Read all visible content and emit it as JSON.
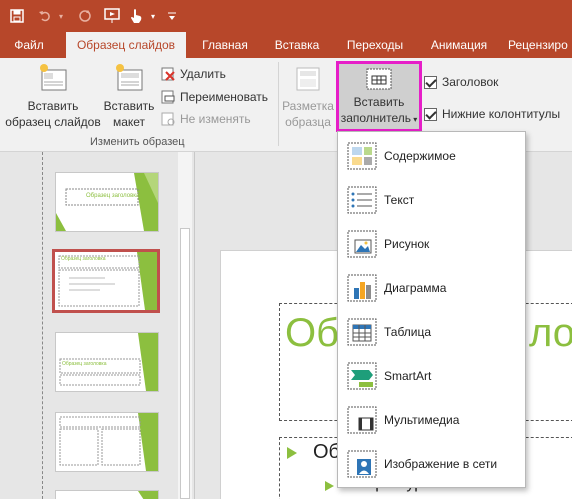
{
  "qat": {
    "save_icon": "save-icon",
    "undo_icon": "undo-icon",
    "redo_icon": "redo-icon",
    "present_icon": "present-from-start-icon",
    "touch_icon": "touch-mode-icon",
    "customize_icon": "customize-qat-icon"
  },
  "tabs": [
    {
      "label": "Файл"
    },
    {
      "label": "Образец слайдов"
    },
    {
      "label": "Главная"
    },
    {
      "label": "Вставка"
    },
    {
      "label": "Переходы"
    },
    {
      "label": "Анимация"
    },
    {
      "label": "Рецензиро"
    }
  ],
  "ribbon": {
    "insert_master_line1": "Вставить",
    "insert_master_line2": "образец слайдов",
    "insert_layout_line1": "Вставить",
    "insert_layout_line2": "макет",
    "delete_label": "Удалить",
    "rename_label": "Переименовать",
    "preserve_label": "Не изменять",
    "group_edit_master": "Изменить образец",
    "master_layout_line1": "Разметка",
    "master_layout_line2": "образца",
    "insert_placeholder_line1": "Вставить",
    "insert_placeholder_line2": "заполнитель",
    "title_checkbox": "Заголовок",
    "footers_checkbox": "Нижние колонтитулы"
  },
  "thumbs": [
    {
      "title": "Образец заголовка"
    },
    {
      "title": "Образец заголовка"
    },
    {
      "title": "Образец заголовка"
    },
    {
      "title": ""
    },
    {
      "title": ""
    }
  ],
  "slide": {
    "title_fragment": "Обр",
    "title_fragment_right": "лог",
    "bullet1": "Об",
    "bullet2": "Второй уровень"
  },
  "menu": [
    {
      "label": "Содержимое",
      "icon": "content-placeholder-icon"
    },
    {
      "label": "Текст",
      "icon": "text-placeholder-icon"
    },
    {
      "label": "Рисунок",
      "icon": "picture-placeholder-icon"
    },
    {
      "label": "Диаграмма",
      "icon": "chart-placeholder-icon"
    },
    {
      "label": "Таблица",
      "icon": "table-placeholder-icon"
    },
    {
      "label": "SmartArt",
      "icon": "smartart-placeholder-icon"
    },
    {
      "label": "Мультимедиа",
      "icon": "media-placeholder-icon"
    },
    {
      "label": "Изображение в сети",
      "icon": "online-image-placeholder-icon"
    }
  ],
  "colors": {
    "brand": "#b7472a",
    "highlight": "#e61ec8",
    "accent_green": "#8cbf3f"
  }
}
